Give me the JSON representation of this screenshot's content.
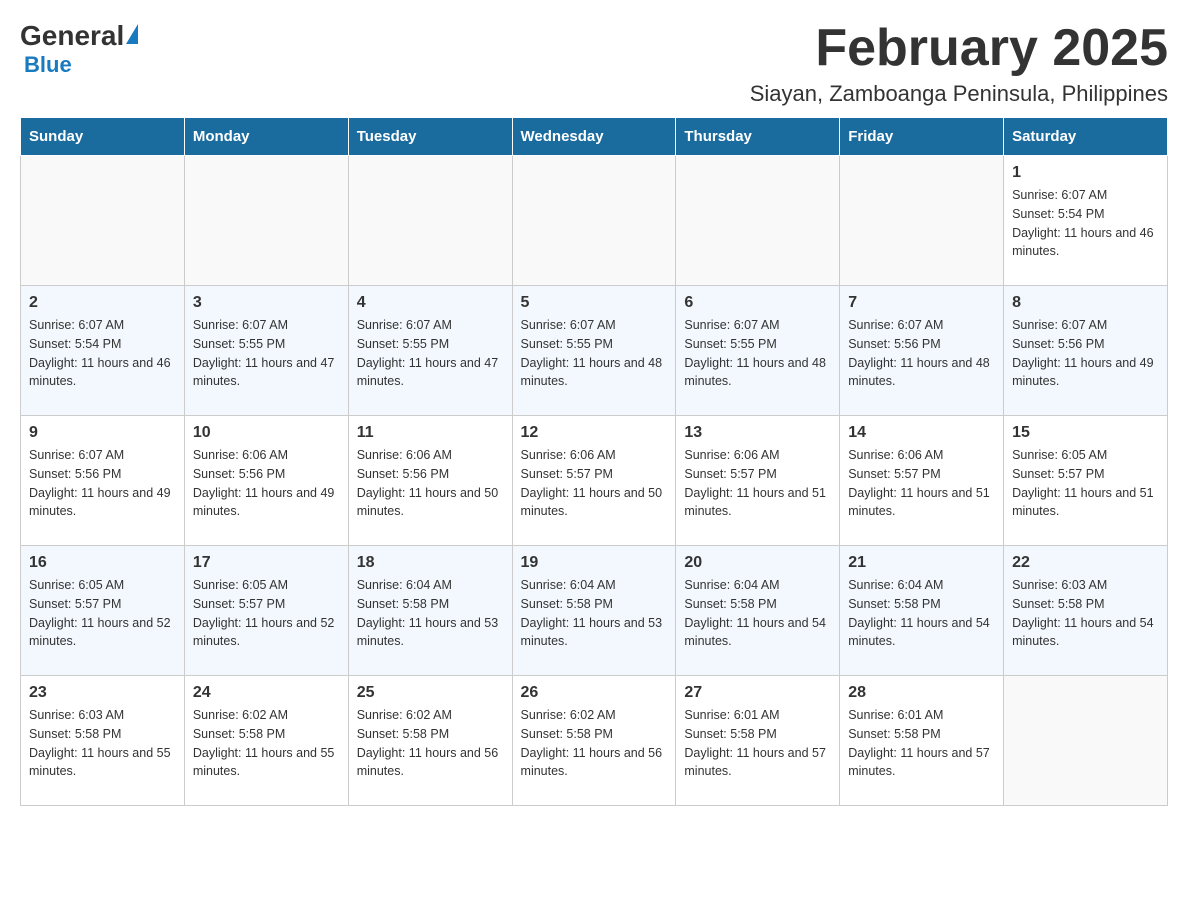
{
  "header": {
    "logo": {
      "general": "General",
      "blue": "Blue"
    },
    "title": "February 2025",
    "location": "Siayan, Zamboanga Peninsula, Philippines"
  },
  "weekdays": [
    "Sunday",
    "Monday",
    "Tuesday",
    "Wednesday",
    "Thursday",
    "Friday",
    "Saturday"
  ],
  "weeks": [
    [
      {
        "day": "",
        "sunrise": "",
        "sunset": "",
        "daylight": ""
      },
      {
        "day": "",
        "sunrise": "",
        "sunset": "",
        "daylight": ""
      },
      {
        "day": "",
        "sunrise": "",
        "sunset": "",
        "daylight": ""
      },
      {
        "day": "",
        "sunrise": "",
        "sunset": "",
        "daylight": ""
      },
      {
        "day": "",
        "sunrise": "",
        "sunset": "",
        "daylight": ""
      },
      {
        "day": "",
        "sunrise": "",
        "sunset": "",
        "daylight": ""
      },
      {
        "day": "1",
        "sunrise": "Sunrise: 6:07 AM",
        "sunset": "Sunset: 5:54 PM",
        "daylight": "Daylight: 11 hours and 46 minutes."
      }
    ],
    [
      {
        "day": "2",
        "sunrise": "Sunrise: 6:07 AM",
        "sunset": "Sunset: 5:54 PM",
        "daylight": "Daylight: 11 hours and 46 minutes."
      },
      {
        "day": "3",
        "sunrise": "Sunrise: 6:07 AM",
        "sunset": "Sunset: 5:55 PM",
        "daylight": "Daylight: 11 hours and 47 minutes."
      },
      {
        "day": "4",
        "sunrise": "Sunrise: 6:07 AM",
        "sunset": "Sunset: 5:55 PM",
        "daylight": "Daylight: 11 hours and 47 minutes."
      },
      {
        "day": "5",
        "sunrise": "Sunrise: 6:07 AM",
        "sunset": "Sunset: 5:55 PM",
        "daylight": "Daylight: 11 hours and 48 minutes."
      },
      {
        "day": "6",
        "sunrise": "Sunrise: 6:07 AM",
        "sunset": "Sunset: 5:55 PM",
        "daylight": "Daylight: 11 hours and 48 minutes."
      },
      {
        "day": "7",
        "sunrise": "Sunrise: 6:07 AM",
        "sunset": "Sunset: 5:56 PM",
        "daylight": "Daylight: 11 hours and 48 minutes."
      },
      {
        "day": "8",
        "sunrise": "Sunrise: 6:07 AM",
        "sunset": "Sunset: 5:56 PM",
        "daylight": "Daylight: 11 hours and 49 minutes."
      }
    ],
    [
      {
        "day": "9",
        "sunrise": "Sunrise: 6:07 AM",
        "sunset": "Sunset: 5:56 PM",
        "daylight": "Daylight: 11 hours and 49 minutes."
      },
      {
        "day": "10",
        "sunrise": "Sunrise: 6:06 AM",
        "sunset": "Sunset: 5:56 PM",
        "daylight": "Daylight: 11 hours and 49 minutes."
      },
      {
        "day": "11",
        "sunrise": "Sunrise: 6:06 AM",
        "sunset": "Sunset: 5:56 PM",
        "daylight": "Daylight: 11 hours and 50 minutes."
      },
      {
        "day": "12",
        "sunrise": "Sunrise: 6:06 AM",
        "sunset": "Sunset: 5:57 PM",
        "daylight": "Daylight: 11 hours and 50 minutes."
      },
      {
        "day": "13",
        "sunrise": "Sunrise: 6:06 AM",
        "sunset": "Sunset: 5:57 PM",
        "daylight": "Daylight: 11 hours and 51 minutes."
      },
      {
        "day": "14",
        "sunrise": "Sunrise: 6:06 AM",
        "sunset": "Sunset: 5:57 PM",
        "daylight": "Daylight: 11 hours and 51 minutes."
      },
      {
        "day": "15",
        "sunrise": "Sunrise: 6:05 AM",
        "sunset": "Sunset: 5:57 PM",
        "daylight": "Daylight: 11 hours and 51 minutes."
      }
    ],
    [
      {
        "day": "16",
        "sunrise": "Sunrise: 6:05 AM",
        "sunset": "Sunset: 5:57 PM",
        "daylight": "Daylight: 11 hours and 52 minutes."
      },
      {
        "day": "17",
        "sunrise": "Sunrise: 6:05 AM",
        "sunset": "Sunset: 5:57 PM",
        "daylight": "Daylight: 11 hours and 52 minutes."
      },
      {
        "day": "18",
        "sunrise": "Sunrise: 6:04 AM",
        "sunset": "Sunset: 5:58 PM",
        "daylight": "Daylight: 11 hours and 53 minutes."
      },
      {
        "day": "19",
        "sunrise": "Sunrise: 6:04 AM",
        "sunset": "Sunset: 5:58 PM",
        "daylight": "Daylight: 11 hours and 53 minutes."
      },
      {
        "day": "20",
        "sunrise": "Sunrise: 6:04 AM",
        "sunset": "Sunset: 5:58 PM",
        "daylight": "Daylight: 11 hours and 54 minutes."
      },
      {
        "day": "21",
        "sunrise": "Sunrise: 6:04 AM",
        "sunset": "Sunset: 5:58 PM",
        "daylight": "Daylight: 11 hours and 54 minutes."
      },
      {
        "day": "22",
        "sunrise": "Sunrise: 6:03 AM",
        "sunset": "Sunset: 5:58 PM",
        "daylight": "Daylight: 11 hours and 54 minutes."
      }
    ],
    [
      {
        "day": "23",
        "sunrise": "Sunrise: 6:03 AM",
        "sunset": "Sunset: 5:58 PM",
        "daylight": "Daylight: 11 hours and 55 minutes."
      },
      {
        "day": "24",
        "sunrise": "Sunrise: 6:02 AM",
        "sunset": "Sunset: 5:58 PM",
        "daylight": "Daylight: 11 hours and 55 minutes."
      },
      {
        "day": "25",
        "sunrise": "Sunrise: 6:02 AM",
        "sunset": "Sunset: 5:58 PM",
        "daylight": "Daylight: 11 hours and 56 minutes."
      },
      {
        "day": "26",
        "sunrise": "Sunrise: 6:02 AM",
        "sunset": "Sunset: 5:58 PM",
        "daylight": "Daylight: 11 hours and 56 minutes."
      },
      {
        "day": "27",
        "sunrise": "Sunrise: 6:01 AM",
        "sunset": "Sunset: 5:58 PM",
        "daylight": "Daylight: 11 hours and 57 minutes."
      },
      {
        "day": "28",
        "sunrise": "Sunrise: 6:01 AM",
        "sunset": "Sunset: 5:58 PM",
        "daylight": "Daylight: 11 hours and 57 minutes."
      },
      {
        "day": "",
        "sunrise": "",
        "sunset": "",
        "daylight": ""
      }
    ]
  ]
}
